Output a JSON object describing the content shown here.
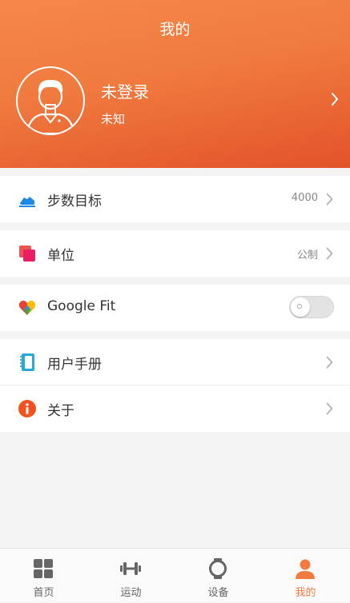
{
  "header": {
    "title": "我的",
    "profile": {
      "name": "未登录",
      "subtitle": "未知"
    }
  },
  "settings": [
    {
      "label": "步数目标",
      "value": "4000",
      "icon": "shoe-icon"
    },
    {
      "label": "单位",
      "value": "公制",
      "icon": "unit-icon"
    },
    {
      "label": "Google Fit",
      "icon": "google-fit-heart-icon",
      "toggle_on": false
    },
    {
      "label": "用户手册",
      "icon": "notebook-icon"
    },
    {
      "label": "关于",
      "icon": "info-icon"
    }
  ],
  "tabs": [
    {
      "label": "首页",
      "icon": "grid-icon",
      "active": false
    },
    {
      "label": "运动",
      "icon": "dumbbell-icon",
      "active": false
    },
    {
      "label": "设备",
      "icon": "watch-icon",
      "active": false
    },
    {
      "label": "我的",
      "icon": "person-icon",
      "active": true
    }
  ],
  "colors": {
    "accent": "#f07d3f",
    "header_top": "#f6874a",
    "header_bottom": "#e3532a",
    "background": "#f4f4f4"
  }
}
